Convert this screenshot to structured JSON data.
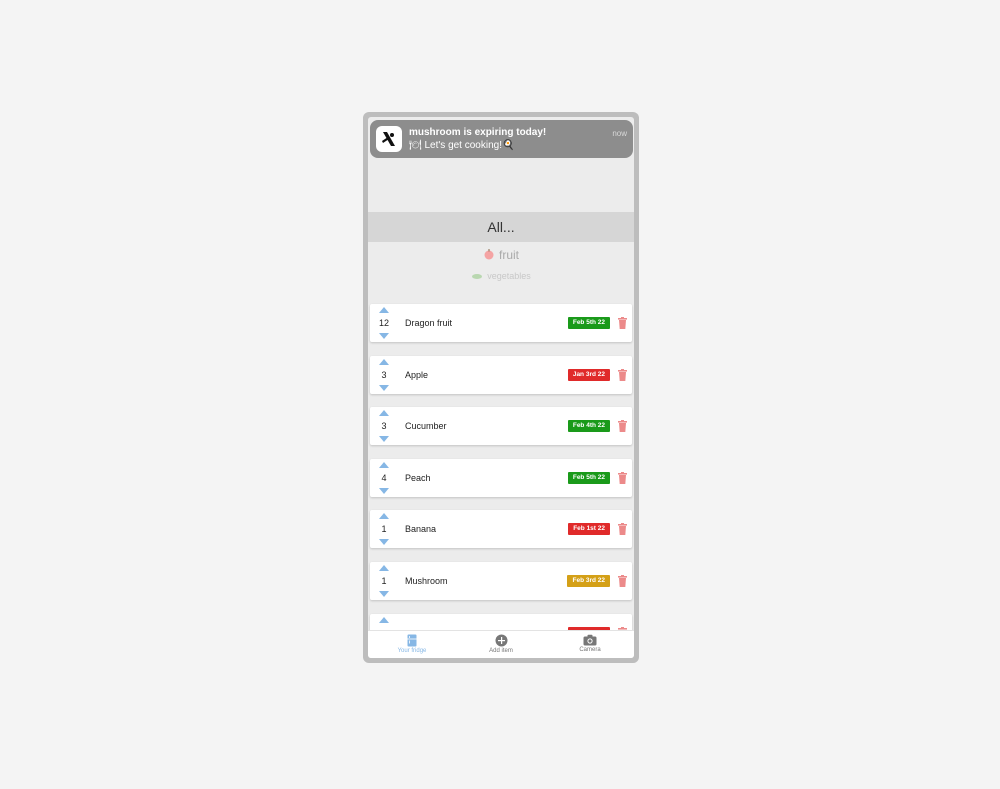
{
  "notification": {
    "title": "mushroom is expiring today!",
    "body": "🍽 Let's get cooking!🍳",
    "time": "now"
  },
  "picker": {
    "selected": "All...",
    "options": [
      {
        "label": "fruit",
        "icon": "apple-icon"
      },
      {
        "label": "vegetables",
        "icon": "carrot-icon"
      }
    ]
  },
  "items": [
    {
      "qty": "12",
      "name": "Dragon fruit",
      "date": "Feb 5th 22",
      "status_color": "#1a9a1a"
    },
    {
      "qty": "3",
      "name": "Apple",
      "date": "Jan 3rd 22",
      "status_color": "#e02a2a"
    },
    {
      "qty": "3",
      "name": " Cucumber",
      "date": "Feb 4th 22",
      "status_color": "#1a9a1a"
    },
    {
      "qty": "4",
      "name": "Peach",
      "date": "Feb 5th 22",
      "status_color": "#1a9a1a"
    },
    {
      "qty": "1",
      "name": "Banana",
      "date": "Feb 1st 22",
      "status_color": "#e02a2a"
    },
    {
      "qty": "1",
      "name": "Mushroom",
      "date": "Feb 3rd 22",
      "status_color": "#d4a017"
    }
  ],
  "partial_item": {
    "status_color": "#e02a2a"
  },
  "tabs": [
    {
      "label": "Your fridge",
      "icon": "fridge-icon",
      "active": true
    },
    {
      "label": "Add item",
      "icon": "plus-circle-icon",
      "active": false
    },
    {
      "label": "Camera",
      "icon": "camera-icon",
      "active": false
    }
  ],
  "colors": {
    "accent": "#86b7e5",
    "tab_inactive": "#777777",
    "trash": "#ec8a8a"
  }
}
